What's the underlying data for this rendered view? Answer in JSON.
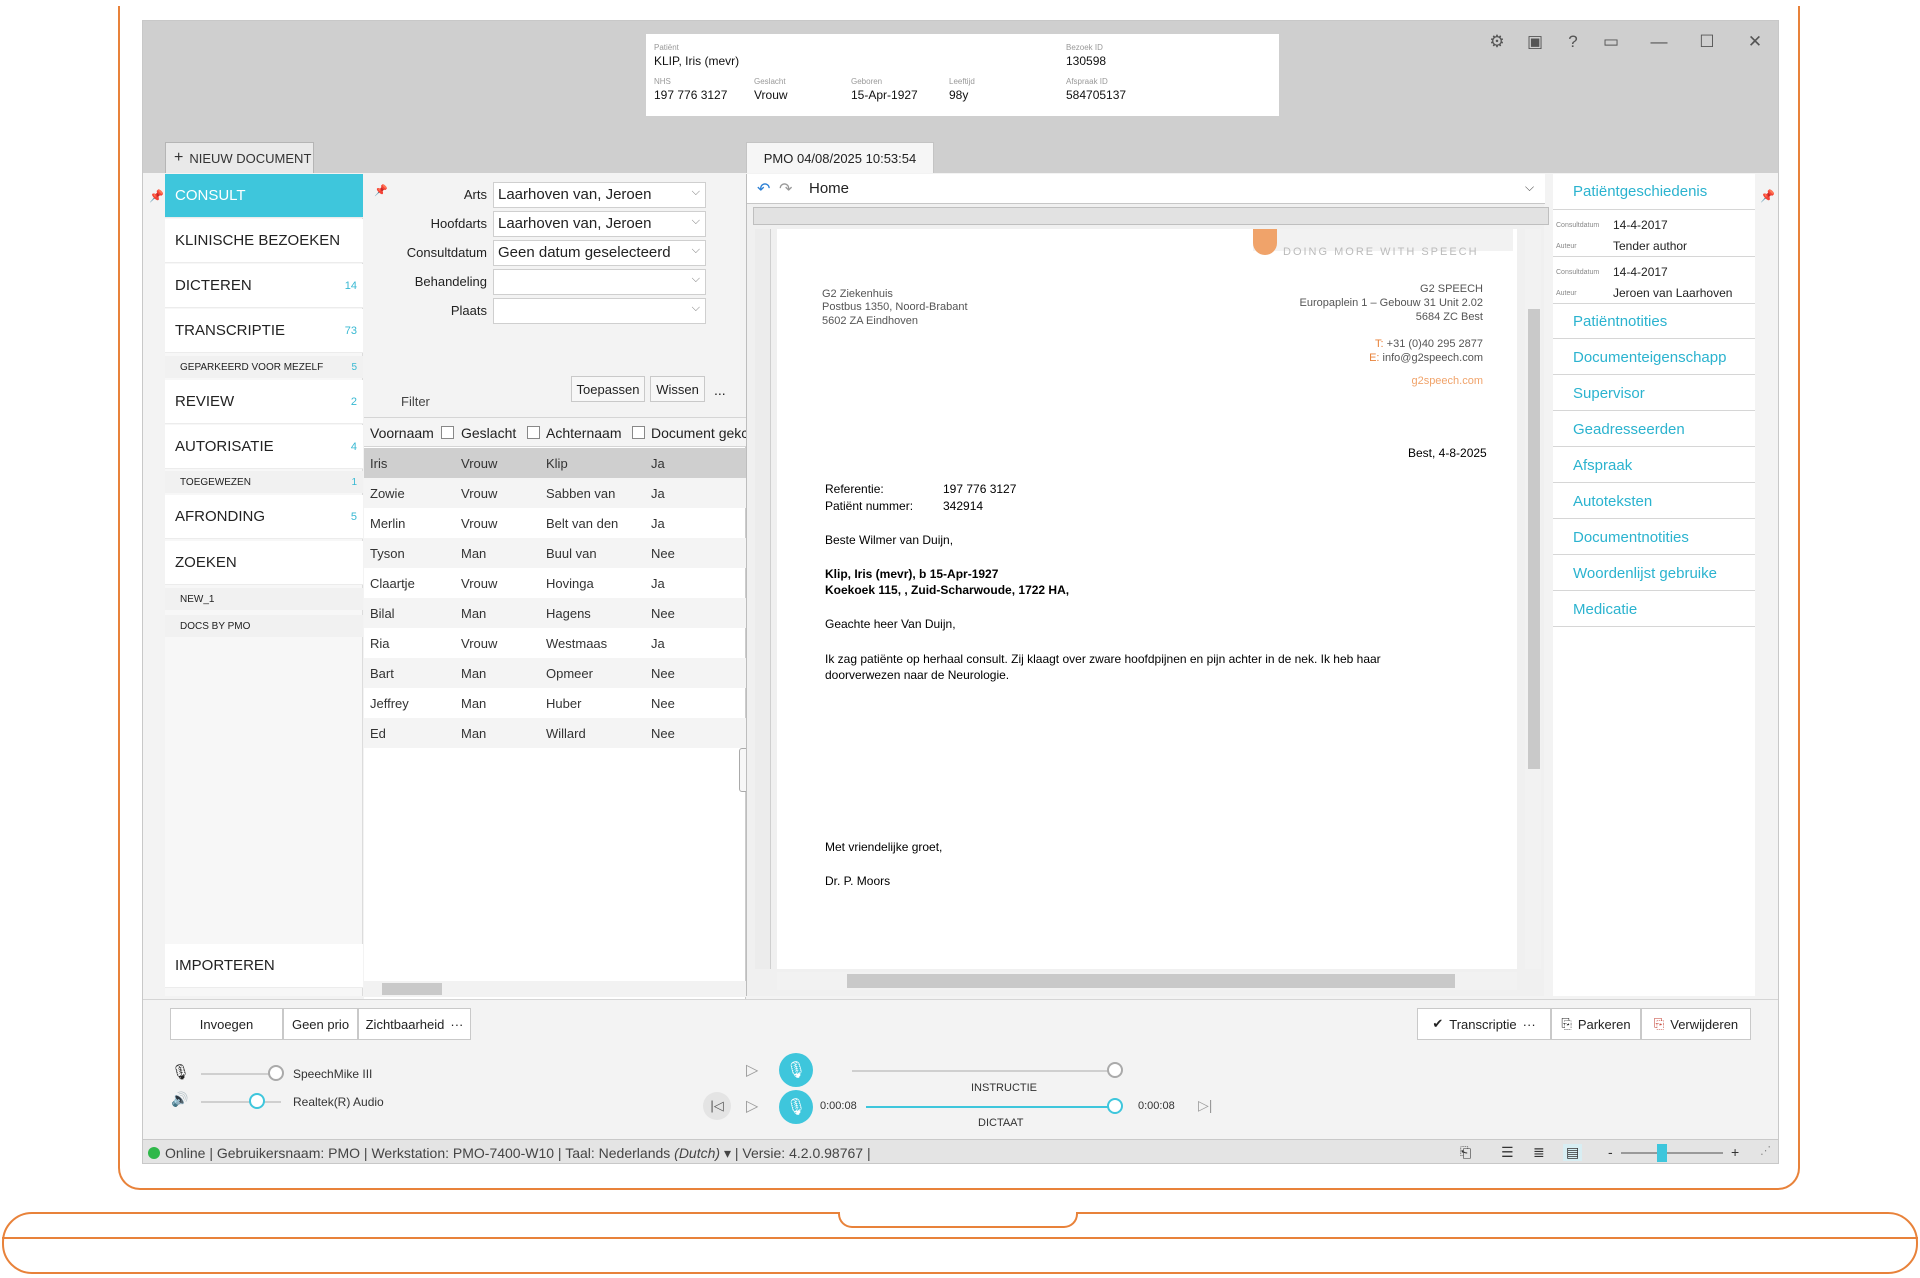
{
  "patient": {
    "patient_label": "Patiënt",
    "name": "KLIP, Iris (mevr)",
    "visit_id_label": "Bezoek ID",
    "visit_id": "130598",
    "nhs_label": "NHS",
    "nhs": "197 776 3127",
    "gender_label": "Geslacht",
    "gender": "Vrouw",
    "born_label": "Geboren",
    "born": "15-Apr-1927",
    "age_label": "Leeftijd",
    "age": "98y",
    "appointment_id_label": "Afspraak ID",
    "appointment_id": "584705137"
  },
  "tabs": {
    "new_document": "NIEUW DOCUMENT",
    "document": "PMO 04/08/2025 10:53:54"
  },
  "nav": {
    "items": [
      {
        "label": "CONSULT",
        "count": ""
      },
      {
        "label": "KLINISCHE BEZOEKEN",
        "count": ""
      },
      {
        "label": "DICTEREN",
        "count": "14"
      },
      {
        "label": "TRANSCRIPTIE",
        "count": "73"
      },
      {
        "label": "REVIEW",
        "count": "2"
      },
      {
        "label": "AUTORISATIE",
        "count": "4"
      },
      {
        "label": "AFRONDING",
        "count": "5"
      },
      {
        "label": "ZOEKEN",
        "count": ""
      },
      {
        "label": "IMPORTEREN",
        "count": ""
      }
    ],
    "sub": {
      "geparkeerd": {
        "label": "GEPARKEERD VOOR MEZELF",
        "count": "5"
      },
      "toegewezen": {
        "label": "TOEGEWEZEN",
        "count": "1"
      },
      "new1": {
        "label": "NEW_1"
      },
      "docs_by_pmo": {
        "label": "DOCS BY PMO"
      }
    }
  },
  "filter": {
    "arts_label": "Arts",
    "arts_value": "Laarhoven van, Jeroen",
    "hoofdarts_label": "Hoofdarts",
    "hoofdarts_value": "Laarhoven van, Jeroen",
    "consultdatum_label": "Consultdatum",
    "consultdatum_value": "Geen datum geselecteerd",
    "behandeling_label": "Behandeling",
    "behandeling_value": "",
    "plaats_label": "Plaats",
    "plaats_value": "",
    "filter_label": "Filter",
    "apply": "Toepassen",
    "clear": "Wissen",
    "more": "..."
  },
  "grid": {
    "columns": [
      "Voornaam",
      "Geslacht",
      "Achternaam",
      "Document gekc"
    ],
    "rows": [
      [
        "Iris",
        "Vrouw",
        "Klip",
        "Ja"
      ],
      [
        "Zowie",
        "Vrouw",
        "Sabben van",
        "Ja"
      ],
      [
        "Merlin",
        "Vrouw",
        "Belt van den",
        "Ja"
      ],
      [
        "Tyson",
        "Man",
        "Buul van",
        "Nee"
      ],
      [
        "Claartje",
        "Vrouw",
        "Hovinga",
        "Ja"
      ],
      [
        "Bilal",
        "Man",
        "Hagens",
        "Nee"
      ],
      [
        "Ria",
        "Vrouw",
        "Westmaas",
        "Ja"
      ],
      [
        "Bart",
        "Man",
        "Opmeer",
        "Nee"
      ],
      [
        "Jeffrey",
        "Man",
        "Huber",
        "Nee"
      ],
      [
        "Ed",
        "Man",
        "Willard",
        "Nee"
      ]
    ]
  },
  "doc_toolbar": {
    "tab": "Home"
  },
  "letter": {
    "slogan": "DOING MORE WITH SPEECH",
    "sender_name": "G2 Ziekenhuis",
    "sender_addr1": "Postbus 1350, Noord-Brabant",
    "sender_addr2": "5602 ZA Eindhoven",
    "company": "G2 SPEECH",
    "company_addr1": "Europaplein 1 – Gebouw 31 Unit 2.02",
    "company_addr2": "5684 ZC Best",
    "phone_prefix": "T:",
    "phone": "+31 (0)40 295 2877",
    "email_prefix": "E:",
    "email": "info@g2speech.com",
    "web": "g2speech.com",
    "date_line": "Best, 4-8-2025",
    "ref_label": "Referentie:",
    "ref_value": "197 776 3127",
    "patnr_label": "Patiënt nummer:",
    "patnr_value": "342914",
    "salutation1": "Beste Wilmer van Duijn,",
    "patient_bold1": "Klip, Iris (mevr), b 15-Apr-1927",
    "patient_bold2": "Koekoek 115, , Zuid-Scharwoude, 1722 HA,",
    "salutation2": "Geachte heer Van Duijn,",
    "body1": "Ik zag patiënte op herhaal consult. Zij klaagt over zware hoofdpijnen en pijn achter in de nek. Ik heb haar",
    "body2": "doorverwezen naar de Neurologie.",
    "closing": "Met vriendelijke groet,",
    "signature": "Dr. P. Moors"
  },
  "right_panel": {
    "history_title": "Patiëntgeschiedenis",
    "history": [
      {
        "date_label": "Consultdatum",
        "date": "14-4-2017",
        "author_label": "Auteur",
        "author": "Tender author"
      },
      {
        "date_label": "Consultdatum",
        "date": "14-4-2017",
        "author_label": "Auteur",
        "author": "Jeroen van Laarhoven"
      }
    ],
    "links": [
      "Patiëntnotities",
      "Documenteigenschapp",
      "Supervisor",
      "Geadresseerden",
      "Afspraak",
      "Autoteksten",
      "Documentnotities",
      "Woordenlijst gebruike",
      "Medicatie"
    ]
  },
  "actions": {
    "invoegen": "Invoegen",
    "geen_prio": "Geen prio",
    "zichtbaarheid": "Zichtbaarheid",
    "more": "···",
    "transcriptie": "Transcriptie",
    "parkeren": "Parkeren",
    "verwijderen": "Verwijderen"
  },
  "audio": {
    "mic_device": "SpeechMike III",
    "speaker_device": "Realtek(R) Audio",
    "instructie_label": "INSTRUCTIE",
    "dictaat_label": "DICTAAT",
    "time_current": "0:00:08",
    "time_total": "0:00:08",
    "dictaat_progress": 1.0
  },
  "status": {
    "text": "Online | Gebruikersnaam: PMO | Werkstation: PMO-7400-W10 | Taal:  Nederlands",
    "lang_native": "(Dutch)",
    "version": "| Versie: 4.2.0.98767 |",
    "zoom_minus": "-",
    "zoom_plus": "+"
  },
  "colors": {
    "accent": "#3ec6dc",
    "laptop_outline": "#e8823a",
    "online": "#2fb84a"
  }
}
